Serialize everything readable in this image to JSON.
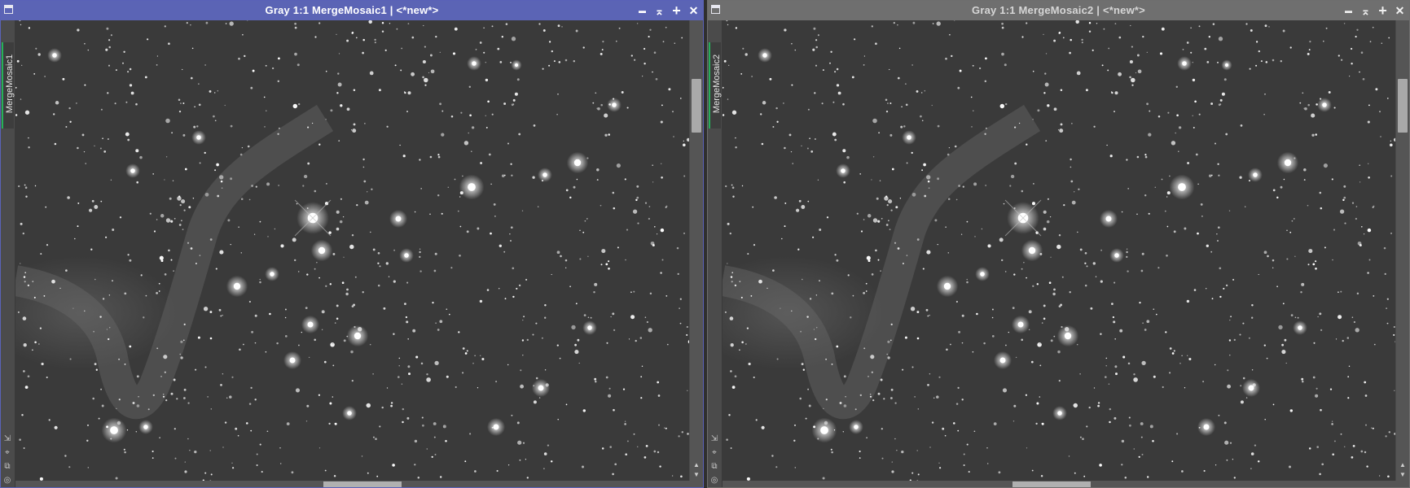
{
  "windows": [
    {
      "title": "Gray 1:1 MergeMosaic1 | <*new*>",
      "tab_label": "MergeMosaic1",
      "active": true
    },
    {
      "title": "Gray 1:1 MergeMosaic2 | <*new*>",
      "tab_label": "MergeMosaic2",
      "active": false
    }
  ],
  "controls": {
    "shade": "▬",
    "restore": "⌅",
    "maximize": "+",
    "close": "✕"
  },
  "icons": {
    "system": "window-menu-icon",
    "left_tools": [
      "resize-icon",
      "zoom-fit-icon",
      "duplicate-view-icon"
    ],
    "scroll_up": "▲",
    "scroll_down": "▼"
  },
  "colors": {
    "active_titlebar": "#5b64b5",
    "inactive_titlebar": "#6f6f6f",
    "view_tab_accent": "#25b05a",
    "image_background": "#3a3a3a"
  }
}
